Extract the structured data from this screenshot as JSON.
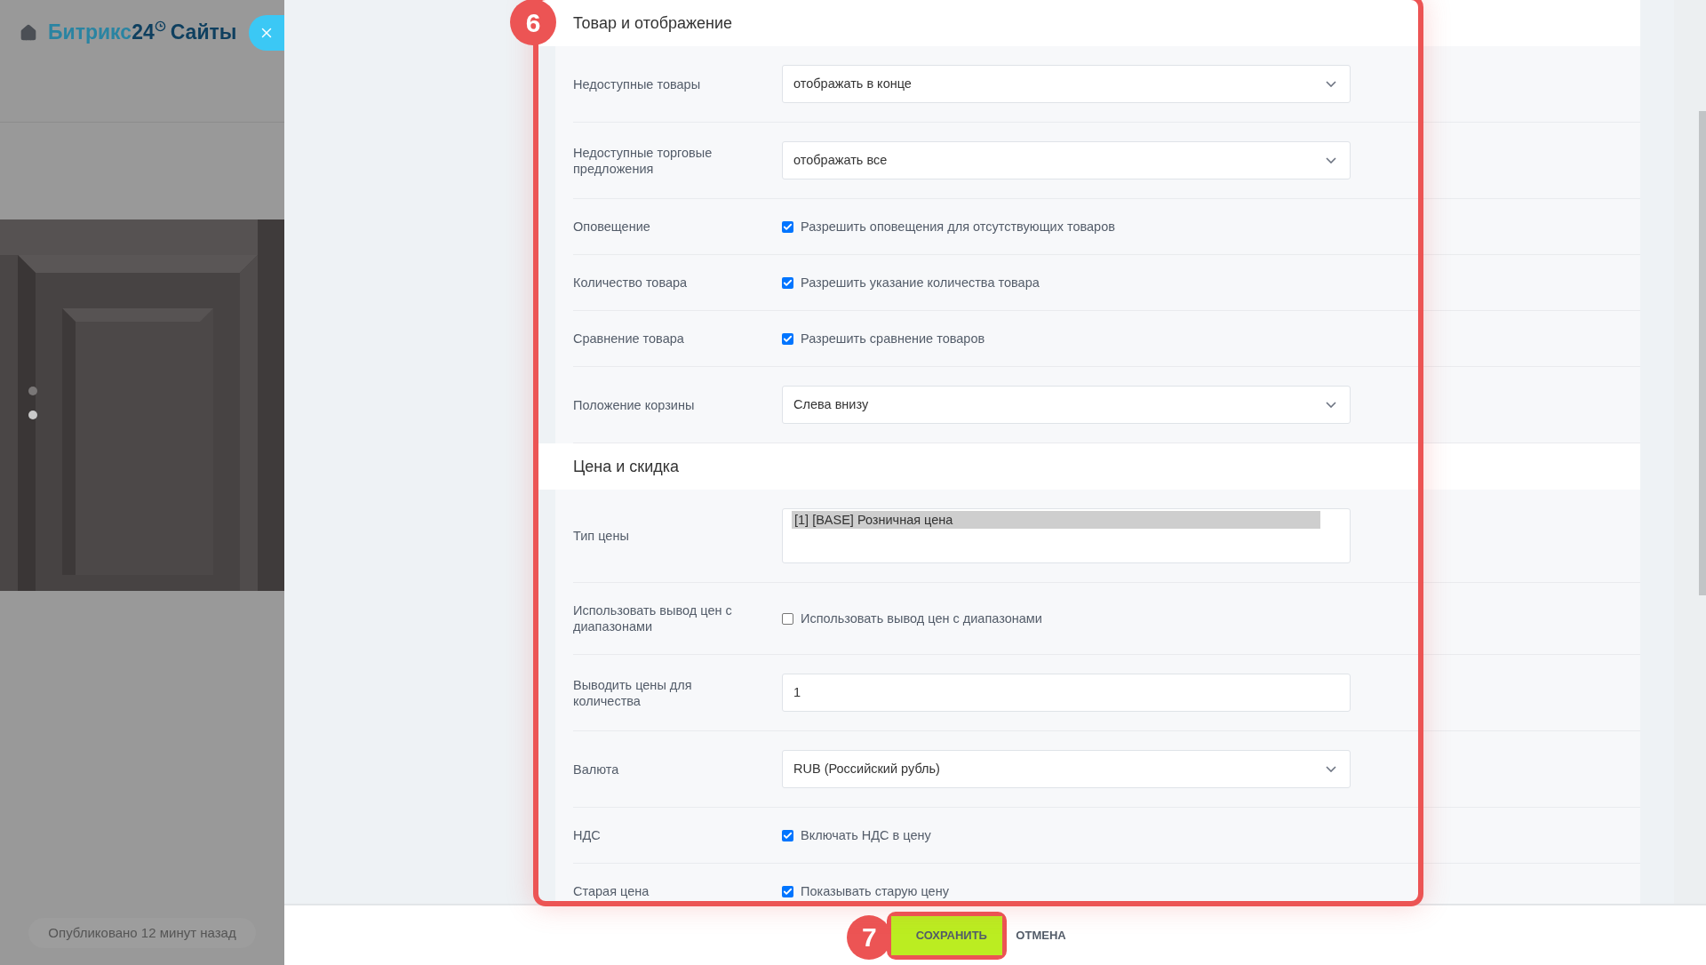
{
  "sidebar": {
    "logo": {
      "name": "Битрикс",
      "number": "24",
      "product": "Сайты"
    },
    "slides": [
      {
        "selected": false
      },
      {
        "selected": true
      }
    ],
    "status": "Опубликовано 12 минут назад"
  },
  "sections": [
    {
      "title": "Товар и отображение",
      "rows": [
        {
          "kind": "select",
          "label": "Недоступные товары",
          "value": "отображать в конце"
        },
        {
          "kind": "select",
          "label": "Недоступные торговые предложения",
          "value": "отображать все"
        },
        {
          "kind": "checkbox",
          "label": "Оповещение",
          "text": "Разрешить оповещения для отсутствующих товаров",
          "checked": true
        },
        {
          "kind": "checkbox",
          "label": "Количество товара",
          "text": "Разрешить указание количества товара",
          "checked": true
        },
        {
          "kind": "checkbox",
          "label": "Сравнение товара",
          "text": "Разрешить сравнение товаров",
          "checked": true
        },
        {
          "kind": "select",
          "label": "Положение корзины",
          "value": "Слева внизу"
        }
      ]
    },
    {
      "title": "Цена и скидка",
      "rows": [
        {
          "kind": "listbox",
          "label": "Тип цены",
          "options": [
            {
              "label": "[1] [BASE] Розничная цена",
              "selected": true
            }
          ]
        },
        {
          "kind": "checkbox",
          "label": "Использовать вывод цен с диапазонами",
          "text": "Использовать вывод цен с диапазонами",
          "checked": false
        },
        {
          "kind": "input",
          "label": "Выводить цены для количества",
          "value": "1"
        },
        {
          "kind": "select",
          "label": "Валюта",
          "value": "RUB (Российский рубль)"
        },
        {
          "kind": "checkbox",
          "label": "НДС",
          "text": "Включать НДС в цену",
          "checked": true
        },
        {
          "kind": "checkbox",
          "label": "Старая цена",
          "text": "Показывать старую цену",
          "checked": true
        }
      ]
    }
  ],
  "footer": {
    "buttons": [
      {
        "kind": "primary",
        "label": "СОХРАНИТЬ"
      },
      {
        "kind": "link",
        "label": "ОТМЕНА"
      }
    ]
  },
  "annotations": [
    {
      "number": "6"
    },
    {
      "number": "7"
    }
  ]
}
